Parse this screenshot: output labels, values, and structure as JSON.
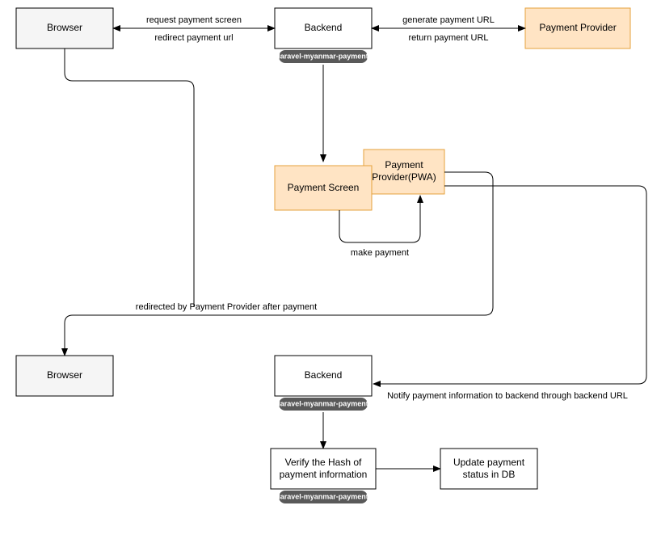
{
  "nodes": {
    "browser1": "Browser",
    "backend1": "Backend",
    "provider": "Payment Provider",
    "paymentScreen": "Payment Screen",
    "providerPwa_l1": "Payment",
    "providerPwa_l2": "Provider(PWA)",
    "browser2": "Browser",
    "backend2": "Backend",
    "verify_l1": "Verify the Hash of",
    "verify_l2": "payment information",
    "update_l1": "Update payment",
    "update_l2": "status in DB"
  },
  "pills": {
    "p1": "laravel-myanmar-payment",
    "p2": "laravel-myanmar-payment",
    "p3": "laravel-myanmar-payment"
  },
  "edges": {
    "reqScreen": "request payment screen",
    "redirectUrl": "redirect payment url",
    "genUrl": "generate payment URL",
    "retUrl": "return payment URL",
    "makePayment": "make payment",
    "redirected": "redirected by Payment Provider after payment",
    "notify": "Notify payment information to backend through backend URL"
  },
  "colors": {
    "grey": "#f5f5f5",
    "orange": "#ffe4c4",
    "orangeStroke": "#e6a23c",
    "pill": "#595959",
    "black": "#000000"
  }
}
